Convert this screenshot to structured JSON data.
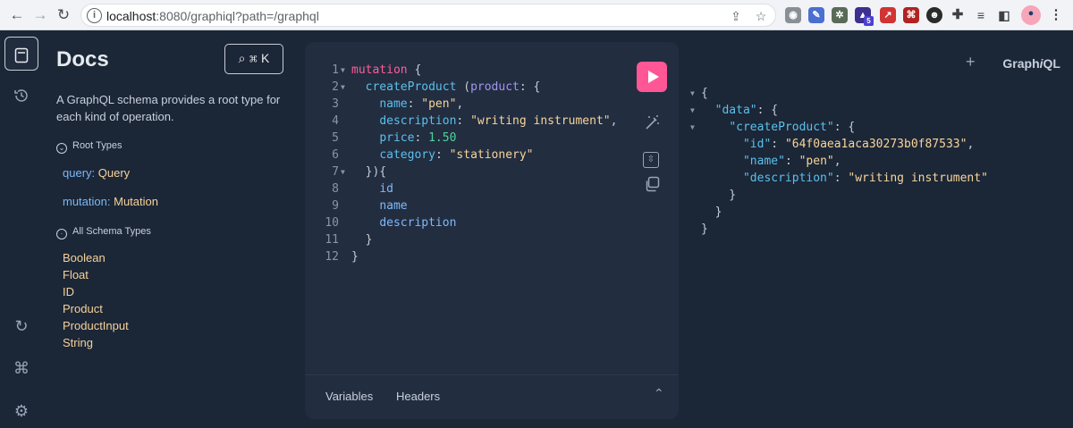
{
  "browser": {
    "back_icon": "←",
    "forward_icon": "→",
    "reload_icon": "↻",
    "url_host": "localhost",
    "url_rest": ":8080/graphiql?path=/graphql",
    "ext_badge": "5"
  },
  "sidebar": {
    "items": [
      "docs-icon",
      "history-icon",
      "refetch-schema-icon",
      "shortcuts-icon",
      "settings-icon"
    ]
  },
  "docs": {
    "title": "Docs",
    "search_shortcut": "⌘ K",
    "description": "A GraphQL schema provides a root type for each kind of operation.",
    "root_types_heading": "Root Types",
    "root_types": [
      {
        "key": "query",
        "type": "Query"
      },
      {
        "key": "mutation",
        "type": "Mutation"
      }
    ],
    "all_types_heading": "All Schema Types",
    "schema_types": [
      "Boolean",
      "Float",
      "ID",
      "Product",
      "ProductInput",
      "String"
    ]
  },
  "editor": {
    "line_numbers": [
      "1",
      "2",
      "3",
      "4",
      "5",
      "6",
      "7",
      "8",
      "9",
      "10",
      "11",
      "12"
    ],
    "footer_tabs": [
      "Variables",
      "Headers"
    ],
    "query": {
      "keyword": "mutation",
      "field": "createProduct",
      "arg": "product",
      "name_key": "name",
      "name_val": "\"pen\"",
      "desc_key": "description",
      "desc_val": "\"writing instrument\"",
      "price_key": "price",
      "price_val": "1.50",
      "cat_key": "category",
      "cat_val": "\"stationery\"",
      "sel_id": "id",
      "sel_name": "name",
      "sel_desc": "description"
    }
  },
  "result": {
    "brand_prefix": "Graph",
    "brand_italic": "i",
    "brand_suffix": "QL",
    "data_key": "\"data\"",
    "op_key": "\"createProduct\"",
    "id_key": "\"id\"",
    "id_val": "\"64f0aea1aca30273b0f87533\"",
    "name_key": "\"name\"",
    "name_val": "\"pen\"",
    "desc_key": "\"description\"",
    "desc_val": "\"writing instrument\""
  },
  "colors": {
    "background": "#1b2637",
    "editor_bg": "#222d40",
    "run_button": "#ff5795",
    "keyword": "#ff5e99",
    "string": "#f8d59a",
    "number": "#4ed39a",
    "field": "#5bc0eb"
  }
}
